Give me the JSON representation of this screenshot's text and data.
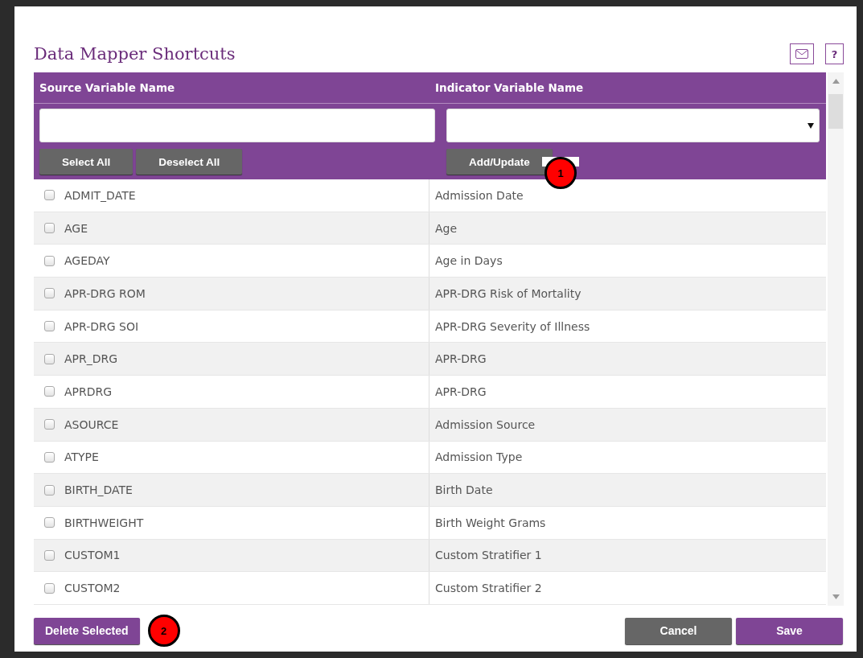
{
  "dialog": {
    "title": "Data Mapper Shortcuts",
    "help_button": "?"
  },
  "table": {
    "columns": [
      "Source Variable Name",
      "Indicator Variable Name"
    ],
    "filter": {
      "source_buttons": [
        "Select All",
        "Deselect All"
      ],
      "indicator_button": "Add/Update"
    },
    "rows": [
      {
        "source": "ADMIT_DATE",
        "indicator": "Admission Date",
        "checked": false
      },
      {
        "source": "AGE",
        "indicator": "Age",
        "checked": false
      },
      {
        "source": "AGEDAY",
        "indicator": "Age in Days",
        "checked": false
      },
      {
        "source": "APR-DRG ROM",
        "indicator": "APR-DRG Risk of Mortality",
        "checked": false
      },
      {
        "source": "APR-DRG SOI",
        "indicator": "APR-DRG Severity of Illness",
        "checked": false
      },
      {
        "source": "APR_DRG",
        "indicator": "APR-DRG",
        "checked": false
      },
      {
        "source": "APRDRG",
        "indicator": "APR-DRG",
        "checked": false
      },
      {
        "source": "ASOURCE",
        "indicator": "Admission Source",
        "checked": false
      },
      {
        "source": "ATYPE",
        "indicator": "Admission Type",
        "checked": false
      },
      {
        "source": "BIRTH_DATE",
        "indicator": "Birth Date",
        "checked": false
      },
      {
        "source": "BIRTHWEIGHT",
        "indicator": "Birth Weight Grams",
        "checked": false
      },
      {
        "source": "CUSTOM1",
        "indicator": "Custom Stratifier 1",
        "checked": false
      },
      {
        "source": "CUSTOM2",
        "indicator": "Custom Stratifier 2",
        "checked": false
      }
    ]
  },
  "footer": {
    "left_button": "Delete Selected",
    "buttons": [
      {
        "label": "Cancel",
        "kind": "secondary"
      },
      {
        "label": "Save",
        "kind": "primary"
      }
    ]
  },
  "callouts": [
    "1",
    "2"
  ]
}
